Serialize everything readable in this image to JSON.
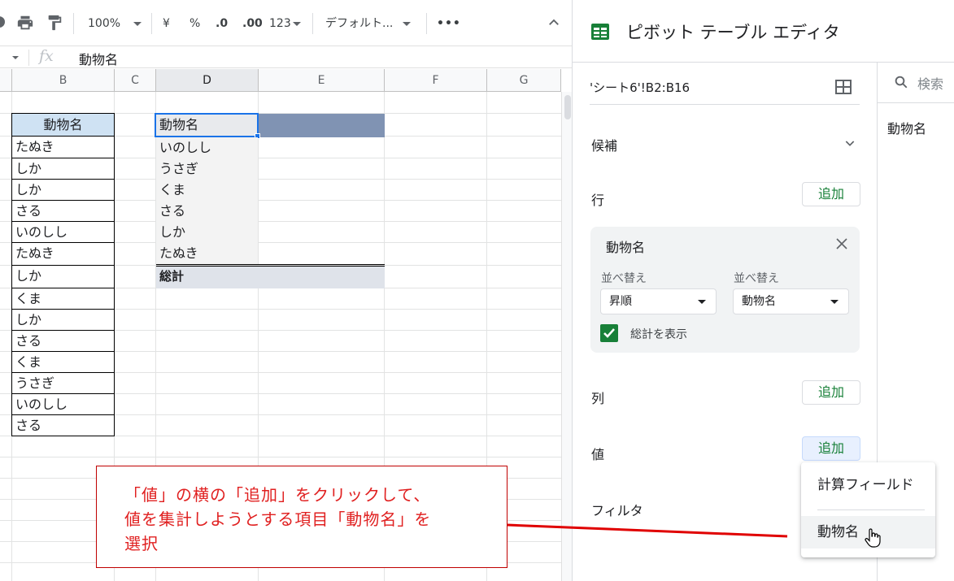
{
  "toolbar": {
    "zoom": "100%",
    "currency": "¥",
    "percent": "%",
    "dec_decrease": ".0",
    "dec_increase": ".00",
    "number_format": "123",
    "font": "デフォルト..."
  },
  "formula_bar": {
    "cell_ref": "",
    "fx": "fx",
    "value": "動物名"
  },
  "grid": {
    "columns": [
      "B",
      "C",
      "D",
      "E",
      "F",
      "G"
    ],
    "source_table": {
      "header": "動物名",
      "rows": [
        "たぬき",
        "しか",
        "しか",
        "さる",
        "いのしし",
        "たぬき",
        "しか",
        "くま",
        "しか",
        "さる",
        "くま",
        "うさぎ",
        "いのしし",
        "さる"
      ]
    },
    "pivot_table": {
      "header": "動物名",
      "rows": [
        "いのしし",
        "うさぎ",
        "くま",
        "さる",
        "しか",
        "たぬき"
      ],
      "total": "総計"
    }
  },
  "panel": {
    "title": "ピボット テーブル エディタ",
    "range": "'シート6'!B2:B16",
    "suggestions_label": "候補",
    "rows_label": "行",
    "add_label": "追加",
    "row_card": {
      "field": "動物名",
      "sort_label_1": "並べ替え",
      "sort_value_1": "昇順",
      "sort_label_2": "並べ替え",
      "sort_value_2": "動物名",
      "show_totals": "総計を表示"
    },
    "columns_label": "列",
    "values_label": "値",
    "filter_label": "フィルタ",
    "search_placeholder": "検索",
    "field_list": [
      "動物名"
    ]
  },
  "menu": {
    "items": [
      "計算フィールド",
      "動物名"
    ]
  },
  "annotation": {
    "lines": [
      "「値」の横の「追加」をクリックして、",
      "値を集計しようとする項目「動物名」を",
      "選択"
    ]
  },
  "colors": {
    "accent_green": "#188038",
    "pivot_header_fill": "#8093b3",
    "annotation_red": "#e02020"
  }
}
